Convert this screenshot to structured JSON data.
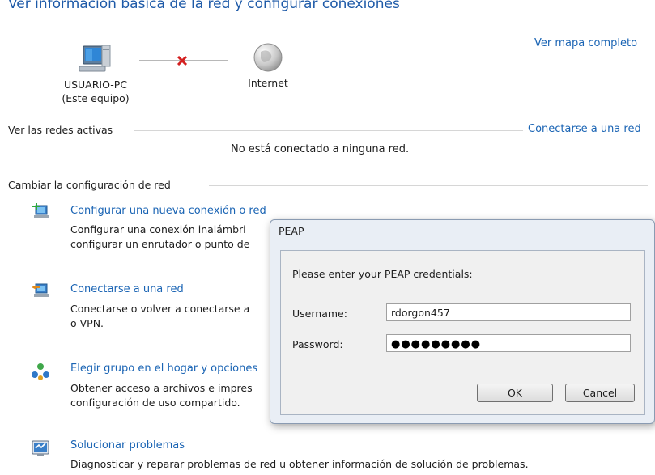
{
  "header": {
    "title": "Ver información básica de la red y configurar conexiones",
    "map_link": "Ver mapa completo"
  },
  "network_map": {
    "computer_name": "USUARIO-PC",
    "computer_sub": "(Este equipo)",
    "internet_label": "Internet",
    "connection_status_icon": "red-x-icon"
  },
  "active_networks": {
    "label": "Ver las redes activas",
    "connect_link": "Conectarse a una red",
    "status_text": "No está conectado a ninguna red."
  },
  "change_settings": {
    "label": "Cambiar la configuración de red",
    "tasks": [
      {
        "icon": "new-connection-icon",
        "title": "Configurar una nueva conexión o red",
        "desc_line1": "Configurar una conexión inalámbri",
        "desc_line2": "configurar un enrutador o punto de"
      },
      {
        "icon": "connect-network-icon",
        "title": "Conectarse a una red",
        "desc_line1": "Conectarse o volver a conectarse a",
        "desc_line2": "o VPN."
      },
      {
        "icon": "homegroup-icon",
        "title": "Elegir grupo en el hogar y opciones",
        "desc_line1": "Obtener acceso a archivos e impres",
        "desc_line2": "configuración de uso compartido."
      },
      {
        "icon": "troubleshoot-icon",
        "title": "Solucionar problemas",
        "desc_line1": "Diagnosticar y reparar problemas de red u obtener información de solución de problemas."
      }
    ]
  },
  "dialog": {
    "title": "PEAP",
    "prompt": "Please enter your PEAP credentials:",
    "username_label": "Username:",
    "username_value": "rdorgon457",
    "password_label": "Password:",
    "password_value": "●●●●●●●●●",
    "ok_label": "OK",
    "cancel_label": "Cancel"
  },
  "colors": {
    "link": "#1a64b4",
    "title": "#1e5aa8",
    "dialog_frame": "#e9eef5"
  }
}
